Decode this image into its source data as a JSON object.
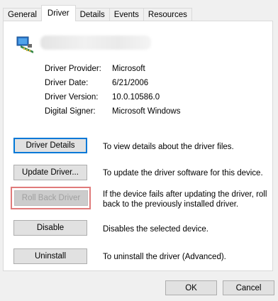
{
  "tabs": [
    "General",
    "Driver",
    "Details",
    "Events",
    "Resources"
  ],
  "properties": [
    {
      "label": "Driver Provider:",
      "value": "Microsoft"
    },
    {
      "label": "Driver Date:",
      "value": "6/21/2006"
    },
    {
      "label": "Driver Version:",
      "value": "10.0.10586.0"
    },
    {
      "label": "Digital Signer:",
      "value": "Microsoft Windows"
    }
  ],
  "actions": [
    {
      "label": "Driver Details",
      "description_lines": [
        "To view details about the driver files."
      ]
    },
    {
      "label": "Update Driver...",
      "description_lines": [
        "To update the driver software for this device."
      ]
    },
    {
      "label": "Roll Back Driver",
      "description_lines": [
        "If the device fails after updating the driver, roll",
        "back to the previously installed driver."
      ]
    },
    {
      "label": "Disable",
      "description_lines": [
        "Disables the selected device."
      ]
    },
    {
      "label": "Uninstall",
      "description_lines": [
        "To uninstall the driver (Advanced)."
      ]
    }
  ],
  "dialog": {
    "ok_label": "OK",
    "cancel_label": "Cancel"
  },
  "icons": {
    "device": "network-adapter-icon"
  },
  "colors": {
    "focus": "#0078d7",
    "highlight": "#e07a7a"
  }
}
